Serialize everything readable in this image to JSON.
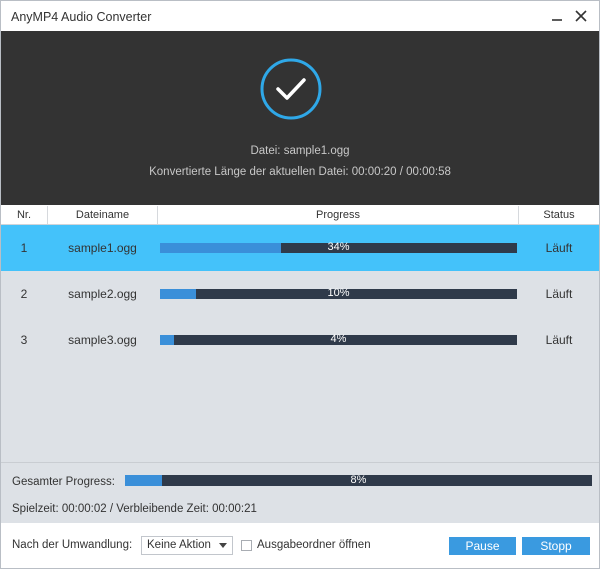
{
  "window": {
    "title": "AnyMP4 Audio Converter"
  },
  "banner": {
    "file_line": "Datei: sample1.ogg",
    "length_line": "Konvertierte Länge der aktuellen Datei: 00:00:20 / 00:00:58"
  },
  "table": {
    "columns": [
      "Nr.",
      "Dateiname",
      "Progress",
      "Status"
    ],
    "rows": [
      {
        "nr": "1",
        "name": "sample1.ogg",
        "progress": 34,
        "progress_label": "34%",
        "status": "Läuft",
        "selected": true
      },
      {
        "nr": "2",
        "name": "sample2.ogg",
        "progress": 10,
        "progress_label": "10%",
        "status": "Läuft",
        "selected": false
      },
      {
        "nr": "3",
        "name": "sample3.ogg",
        "progress": 4,
        "progress_label": "4%",
        "status": "Läuft",
        "selected": false
      }
    ]
  },
  "summary": {
    "total_label": "Gesamter Progress:",
    "total_progress": 8,
    "total_progress_label": "8%",
    "time_line": "Spielzeit: 00:00:02 / Verbleibende Zeit: 00:00:21"
  },
  "footer": {
    "after_label": "Nach der Umwandlung:",
    "after_value": "Keine Aktion",
    "open_folder_label": "Ausgabeordner öffnen",
    "pause_label": "Pause",
    "stop_label": "Stopp"
  },
  "colors": {
    "selected_row": "#44c2fa",
    "progress_fill": "#3a8fd9",
    "progress_track": "#2f3a4a",
    "button": "#3a9ae0",
    "banner_bg": "#333333",
    "check_ring": "#2fa8e8"
  },
  "icons": {
    "minimize": "minimize-icon",
    "close": "close-icon",
    "success": "checkmark-circle-icon",
    "dropdown": "chevron-down-icon"
  }
}
